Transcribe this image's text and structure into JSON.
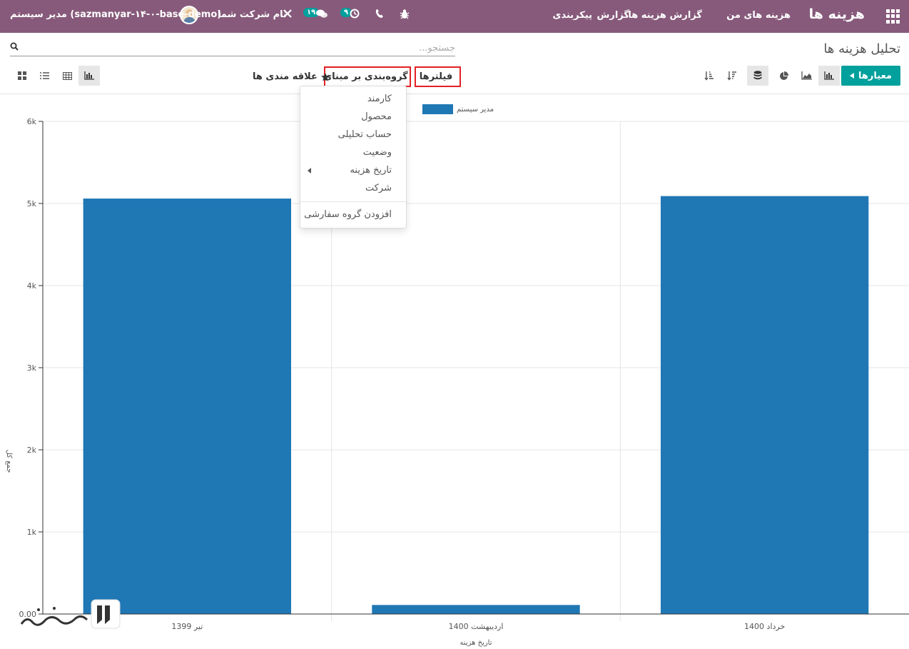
{
  "navbar": {
    "brand": "هزینه ها",
    "menu": [
      "هزینه های من",
      "گزارش هزینه ها",
      "گزارش",
      "پیکربندی"
    ],
    "company": "نام شرکت شما",
    "user": "مدیر سیستم (sazmanyar-۱۴-۰-base-demo)",
    "activity_badge": "۹",
    "chat_badge": "۱۹",
    "icons": [
      "apps-icon",
      "bug-icon",
      "phone-icon",
      "clock-icon",
      "chat-icon",
      "tools-icon",
      "avatar"
    ]
  },
  "control_panel": {
    "title": "تحلیل هزینه ها",
    "search_placeholder": "جستجو...",
    "measures_label": "معیارها",
    "filters_label": "فیلترها",
    "groupby_label": "گروه‌بندی بر مبنای",
    "favorites_label": "علاقه مندی ها"
  },
  "groupby_menu": {
    "items": [
      "کارمند",
      "محصول",
      "حساب تحلیلی",
      "وضعیت",
      "تاریخ هزینه",
      "شرکت"
    ],
    "custom_group": "افزودن گروه سفارشی"
  },
  "colors": {
    "navbar": "#875a7b",
    "primary": "#00a09d",
    "bar": "#1f77b4",
    "highlight": "#e22125"
  },
  "chart_data": {
    "type": "bar",
    "categories": [
      "خرداد 1400",
      "اردیبهشت 1400",
      "تیر 1399"
    ],
    "series": [
      {
        "name": "مدیر سیستم",
        "values": [
          5090,
          110,
          5060
        ]
      }
    ],
    "xlabel": "تاریخ هزینه",
    "ylabel": "جمع کل",
    "ylim": [
      0,
      6000
    ],
    "yticks": [
      "0.00",
      "1k",
      "2k",
      "3k",
      "4k",
      "5k",
      "6k"
    ],
    "grid": true,
    "legend": "top"
  }
}
